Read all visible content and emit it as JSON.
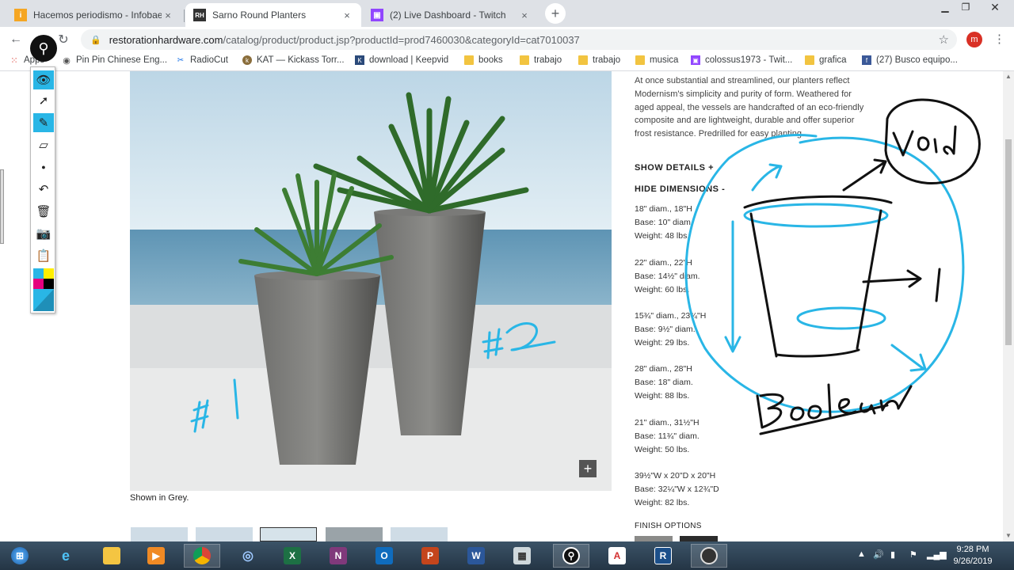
{
  "tabs": [
    {
      "label": "Hacemos periodismo - Infobae",
      "favicon": "infobae-icon",
      "active": false
    },
    {
      "label": "Sarno Round Planters",
      "favicon": "rh-icon",
      "active": true
    },
    {
      "label": "(2) Live Dashboard - Twitch",
      "favicon": "twitch-icon",
      "active": false
    }
  ],
  "tab_close_glyph": "×",
  "new_tab_glyph": "+",
  "address": {
    "host": "restorationhardware.com",
    "path": "/catalog/product/product.jsp?productId=prod7460030&categoryId=cat7010037"
  },
  "profile_initial": "m",
  "bookmarks": [
    {
      "label": "Apps",
      "icon": "apps-grid-icon"
    },
    {
      "label": "Pin Pin Chinese Eng...",
      "icon": "globe-icon"
    },
    {
      "label": "RadioCut",
      "icon": "radiocut-icon"
    },
    {
      "label": "KAT — Kickass Torr...",
      "icon": "kat-icon"
    },
    {
      "label": "download | Keepvid",
      "icon": "keepvid-icon"
    },
    {
      "label": "books",
      "icon": "folder-icon"
    },
    {
      "label": "trabajo",
      "icon": "folder-icon"
    },
    {
      "label": "trabajo",
      "icon": "folder-icon"
    },
    {
      "label": "musica",
      "icon": "folder-icon"
    },
    {
      "label": "colossus1973 - Twit...",
      "icon": "twitch-icon"
    },
    {
      "label": "grafica",
      "icon": "folder-icon"
    },
    {
      "label": "(27) Busco equipo...",
      "icon": "facebook-icon"
    }
  ],
  "product": {
    "description": "At once substantial and streamlined, our planters reflect Modernism's simplicity and purity of form. Weathered for aged appeal, the vessels are handcrafted of an eco-friendly composite and are lightweight, durable and offer superior frost resistance. Predrilled for easy planting.",
    "show_details": "SHOW DETAILS +",
    "hide_dimensions": "HIDE DIMENSIONS -",
    "caption": "Shown in Grey.",
    "finish_label": "FINISH OPTIONS",
    "zoom_glyph": "+",
    "dimensions": [
      [
        "18\" diam., 18\"H",
        "Base: 10\" diam.",
        "Weight: 48 lbs."
      ],
      [
        "22\" diam., 22\"H",
        "Base: 14½\" diam.",
        "Weight: 60 lbs."
      ],
      [
        "15¾\" diam., 23¾\"H",
        "Base: 9½\" diam.",
        "Weight: 29 lbs."
      ],
      [
        "28\" diam., 28\"H",
        "Base: 18\" diam.",
        "Weight: 88 lbs."
      ],
      [
        "21\" diam., 31½\"H",
        "Base: 11¾\" diam.",
        "Weight: 50 lbs."
      ],
      [
        "39½\"W x 20\"D x 20\"H",
        "Base: 32¼\"W x 12¾\"D",
        "Weight: 82 lbs."
      ]
    ]
  },
  "annotations": {
    "label_1": "#1",
    "label_2": "#2",
    "void": "Void",
    "boolean": "Boolean",
    "one": "1",
    "ink_color": "#29b6e6",
    "black_ink": "#111111"
  },
  "palette_tools": [
    "eye-icon",
    "pointer-icon",
    "highlighter-icon",
    "eraser-icon",
    "dot-icon",
    "undo-icon",
    "trash-icon",
    "camera-icon",
    "clipboard-icon",
    "color-picker-icon"
  ],
  "taskbar": {
    "apps": [
      "start-orb-icon",
      "ie-icon",
      "file-explorer-icon",
      "media-player-icon",
      "chrome-icon",
      "app-swirl-icon",
      "excel-icon",
      "onenote-icon",
      "outlook-icon",
      "powerpoint-icon",
      "word-icon",
      "calculator-icon",
      "annotate-icon",
      "acrobat-icon",
      "revit-icon",
      "obs-icon"
    ],
    "time": "9:28 PM",
    "date": "9/26/2019"
  }
}
